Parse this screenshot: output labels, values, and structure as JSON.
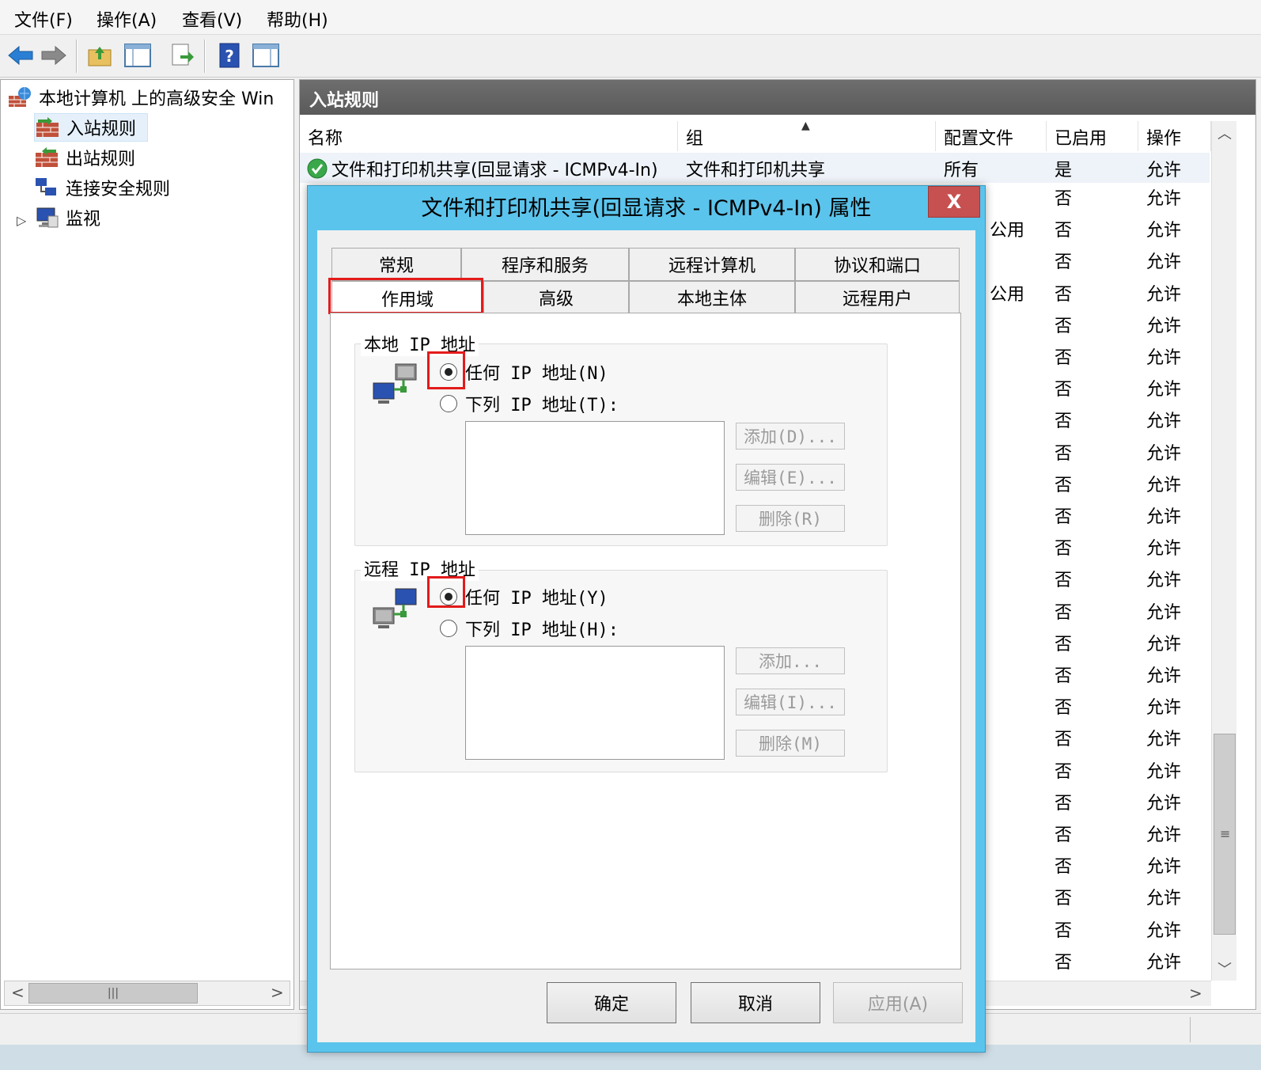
{
  "menubar": [
    "文件(F)",
    "操作(A)",
    "查看(V)",
    "帮助(H)"
  ],
  "tree": {
    "root": "本地计算机 上的高级安全 Win",
    "items": [
      "入站规则",
      "出站规则",
      "连接安全规则",
      "监视"
    ]
  },
  "main": {
    "header": "入站规则",
    "columns": [
      "名称",
      "组",
      "配置文件",
      "已启用",
      "操作"
    ],
    "first_row": {
      "name": "文件和打印机共享(回显请求 - ICMPv4-In)",
      "group": "文件和打印机共享",
      "profile": "所有",
      "enabled": "是",
      "action": "允许"
    },
    "profiles": [
      "",
      "公用",
      "",
      "公用",
      "",
      "",
      "",
      "",
      "",
      "",
      "",
      "",
      "",
      "",
      "",
      "",
      "",
      "",
      "",
      "",
      "",
      "",
      "",
      "",
      ""
    ],
    "enabled": [
      "否",
      "否",
      "否",
      "否",
      "否",
      "否",
      "否",
      "否",
      "否",
      "否",
      "否",
      "否",
      "否",
      "否",
      "否",
      "否",
      "否",
      "否",
      "否",
      "否",
      "否",
      "否",
      "否",
      "否",
      "否"
    ],
    "actions": [
      "允许",
      "允许",
      "允许",
      "允许",
      "允许",
      "允许",
      "允许",
      "允许",
      "允许",
      "允许",
      "允许",
      "允许",
      "允许",
      "允许",
      "允许",
      "允许",
      "允许",
      "允许",
      "允许",
      "允许",
      "允许",
      "允许",
      "允许",
      "允许",
      "允许"
    ]
  },
  "dialog": {
    "title": "文件和打印机共享(回显请求 - ICMPv4-In) 属性",
    "close": "X",
    "tabs_row1": [
      "常规",
      "程序和服务",
      "远程计算机",
      "协议和端口"
    ],
    "tabs_row2": [
      "作用域",
      "高级",
      "本地主体",
      "远程用户"
    ],
    "local": {
      "label": "本地 IP 地址",
      "any": "任何 IP 地址(N)",
      "these": "下列 IP 地址(T):",
      "add": "添加(D)...",
      "edit": "编辑(E)...",
      "remove": "删除(R)"
    },
    "remote": {
      "label": "远程 IP 地址",
      "any": "任何 IP 地址(Y)",
      "these": "下列 IP 地址(H):",
      "add": "添加...",
      "edit": "编辑(I)...",
      "remove": "删除(M)"
    },
    "ok": "确定",
    "cancel": "取消",
    "apply": "应用(A)"
  },
  "colors": {
    "dialog_frame": "#5bc4ec",
    "highlight": "#e31b1b",
    "close_button": "#c75050"
  }
}
